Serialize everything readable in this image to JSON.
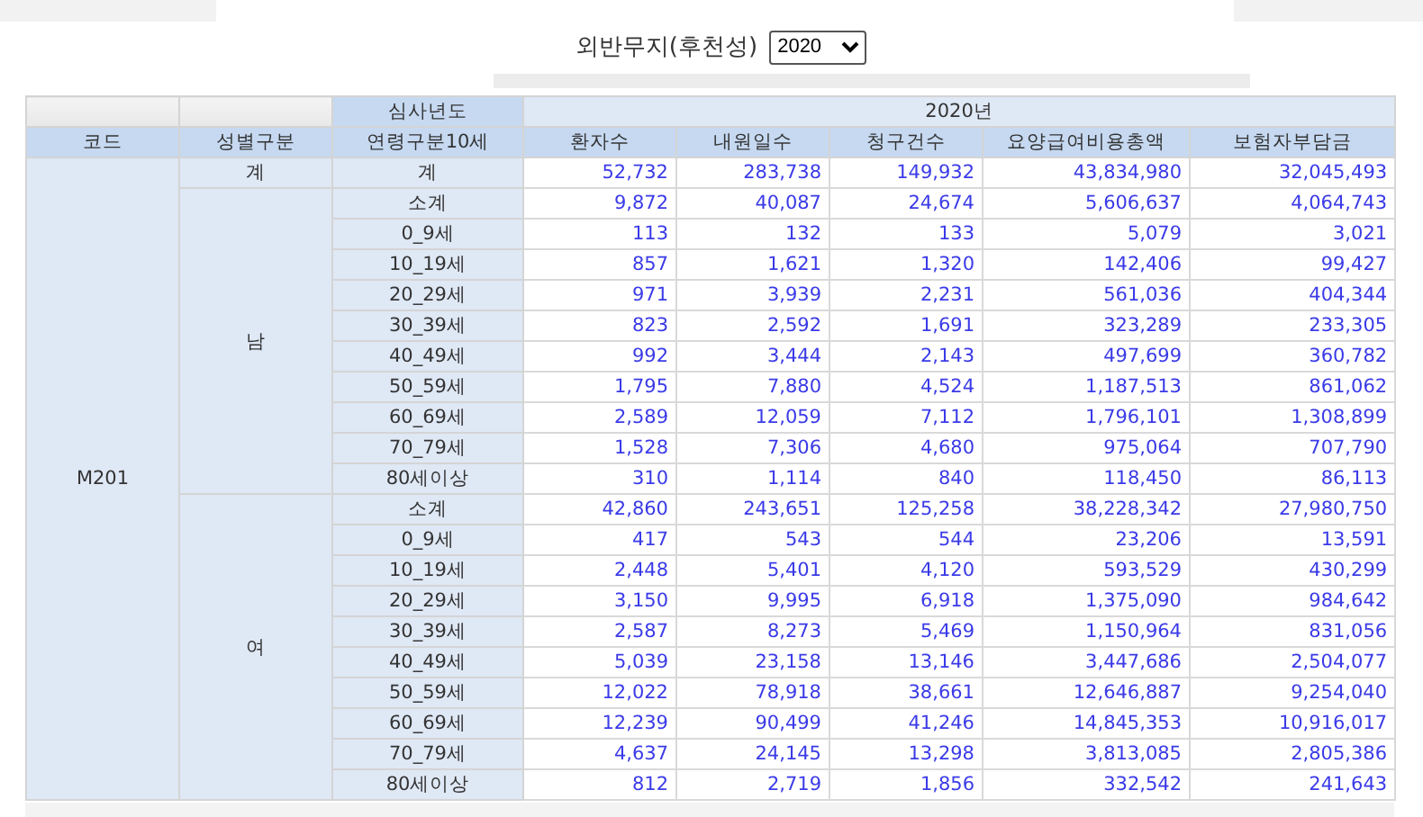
{
  "title": "외반무지(후천성)",
  "year_select": {
    "value": "2020"
  },
  "table": {
    "corner_label": "심사년도",
    "year_label": "2020년",
    "columns": [
      "코드",
      "성별구분",
      "연령구분10세",
      "환자수",
      "내원일수",
      "청구건수",
      "요양급여비용총액",
      "보험자부담금"
    ],
    "groups": [
      {
        "code": "M201",
        "sections": [
          {
            "sex": "계",
            "rows": [
              {
                "age": "계",
                "values": [
                  "52,732",
                  "283,738",
                  "149,932",
                  "43,834,980",
                  "32,045,493"
                ]
              }
            ]
          },
          {
            "sex": "남",
            "rows": [
              {
                "age": "소계",
                "values": [
                  "9,872",
                  "40,087",
                  "24,674",
                  "5,606,637",
                  "4,064,743"
                ]
              },
              {
                "age": "0_9세",
                "values": [
                  "113",
                  "132",
                  "133",
                  "5,079",
                  "3,021"
                ]
              },
              {
                "age": "10_19세",
                "values": [
                  "857",
                  "1,621",
                  "1,320",
                  "142,406",
                  "99,427"
                ]
              },
              {
                "age": "20_29세",
                "values": [
                  "971",
                  "3,939",
                  "2,231",
                  "561,036",
                  "404,344"
                ]
              },
              {
                "age": "30_39세",
                "values": [
                  "823",
                  "2,592",
                  "1,691",
                  "323,289",
                  "233,305"
                ]
              },
              {
                "age": "40_49세",
                "values": [
                  "992",
                  "3,444",
                  "2,143",
                  "497,699",
                  "360,782"
                ]
              },
              {
                "age": "50_59세",
                "values": [
                  "1,795",
                  "7,880",
                  "4,524",
                  "1,187,513",
                  "861,062"
                ]
              },
              {
                "age": "60_69세",
                "values": [
                  "2,589",
                  "12,059",
                  "7,112",
                  "1,796,101",
                  "1,308,899"
                ]
              },
              {
                "age": "70_79세",
                "values": [
                  "1,528",
                  "7,306",
                  "4,680",
                  "975,064",
                  "707,790"
                ]
              },
              {
                "age": "80세이상",
                "values": [
                  "310",
                  "1,114",
                  "840",
                  "118,450",
                  "86,113"
                ]
              }
            ]
          },
          {
            "sex": "여",
            "rows": [
              {
                "age": "소계",
                "values": [
                  "42,860",
                  "243,651",
                  "125,258",
                  "38,228,342",
                  "27,980,750"
                ]
              },
              {
                "age": "0_9세",
                "values": [
                  "417",
                  "543",
                  "544",
                  "23,206",
                  "13,591"
                ]
              },
              {
                "age": "10_19세",
                "values": [
                  "2,448",
                  "5,401",
                  "4,120",
                  "593,529",
                  "430,299"
                ]
              },
              {
                "age": "20_29세",
                "values": [
                  "3,150",
                  "9,995",
                  "6,918",
                  "1,375,090",
                  "984,642"
                ]
              },
              {
                "age": "30_39세",
                "values": [
                  "2,587",
                  "8,273",
                  "5,469",
                  "1,150,964",
                  "831,056"
                ]
              },
              {
                "age": "40_49세",
                "values": [
                  "5,039",
                  "23,158",
                  "13,146",
                  "3,447,686",
                  "2,504,077"
                ]
              },
              {
                "age": "50_59세",
                "values": [
                  "12,022",
                  "78,918",
                  "38,661",
                  "12,646,887",
                  "9,254,040"
                ]
              },
              {
                "age": "60_69세",
                "values": [
                  "12,239",
                  "90,499",
                  "41,246",
                  "14,845,353",
                  "10,916,017"
                ]
              },
              {
                "age": "70_79세",
                "values": [
                  "4,637",
                  "24,145",
                  "13,298",
                  "3,813,085",
                  "2,805,386"
                ]
              },
              {
                "age": "80세이상",
                "values": [
                  "812",
                  "2,719",
                  "1,856",
                  "332,542",
                  "241,643"
                ]
              }
            ]
          }
        ]
      }
    ]
  }
}
